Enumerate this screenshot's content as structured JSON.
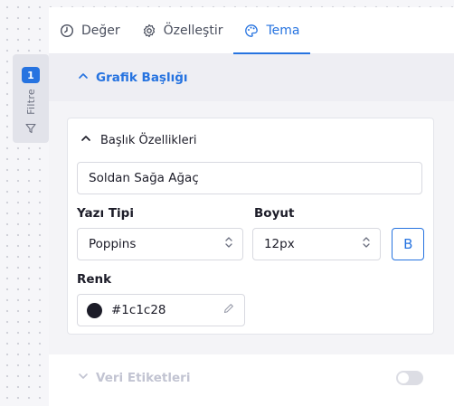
{
  "filter_tab": {
    "badge": "1",
    "label": "Filtre"
  },
  "tabs": [
    {
      "label": "Değer",
      "icon": "clock-icon",
      "active": false
    },
    {
      "label": "Özelleştir",
      "icon": "gear-icon",
      "active": false
    },
    {
      "label": "Tema",
      "icon": "palette-icon",
      "active": true
    }
  ],
  "chart_title_section": {
    "title": "Grafik Başlığı",
    "expanded": true,
    "card": {
      "title": "Başlık Özellikleri",
      "title_text": "Soldan Sağa Ağaç",
      "font_label": "Yazı Tipi",
      "font_value": "Poppins",
      "size_label": "Boyut",
      "size_value": "12px",
      "bold_label": "B",
      "color_label": "Renk",
      "color_value": "#1c1c28"
    }
  },
  "data_labels_section": {
    "title": "Veri Etiketleri",
    "enabled": false
  },
  "colors": {
    "accent": "#2673e0",
    "text": "#1c1c28",
    "muted": "#c2c4d2"
  }
}
